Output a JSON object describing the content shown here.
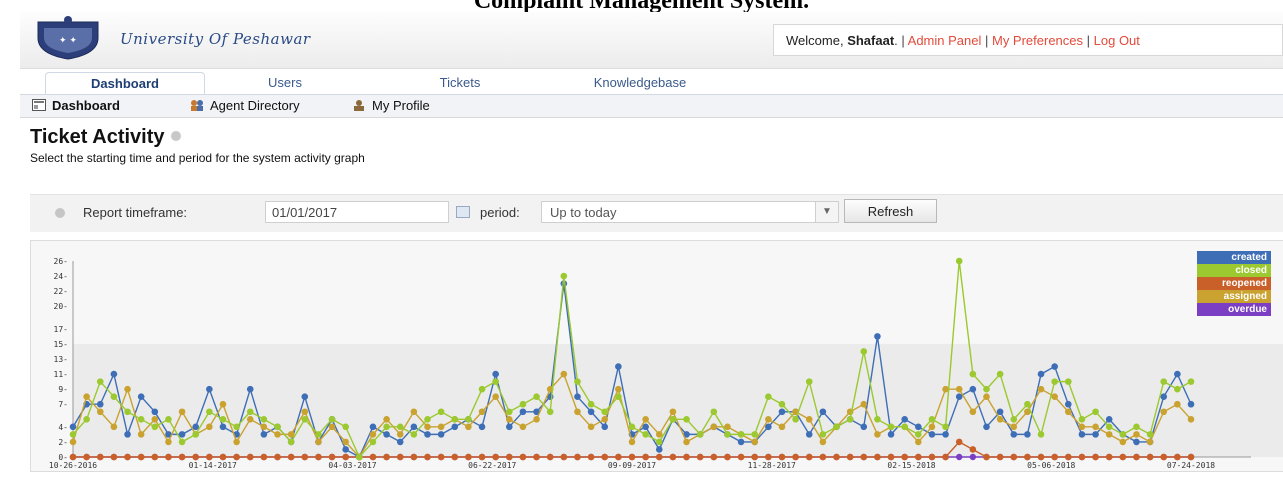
{
  "page_title": "Complaint Management System.",
  "header": {
    "logo_text": "University Of Peshawar",
    "welcome_prefix": "Welcome,",
    "user_name": "Shafaat",
    "links": [
      "Admin Panel",
      "My Preferences",
      "Log Out"
    ]
  },
  "tabs": [
    "Dashboard",
    "Users",
    "Tickets",
    "Knowledgebase"
  ],
  "subnav": [
    "Dashboard",
    "Agent Directory",
    "My Profile"
  ],
  "section": {
    "title": "Ticket Activity",
    "description": "Select the starting time and period for the system activity graph"
  },
  "filter": {
    "label": "Report timeframe:",
    "date_value": "01/01/2017",
    "period_label": "period:",
    "period_value": "Up to today",
    "refresh_label": "Refresh"
  },
  "colors": {
    "created": "#3d6eb6",
    "closed": "#9bc92f",
    "reopened": "#c9602a",
    "assigned": "#c9a22f",
    "overdue": "#7a3fc3"
  },
  "chart_data": {
    "type": "line",
    "y_ticks": [
      "0",
      "2",
      "4",
      "7",
      "9",
      "11",
      "13",
      "15",
      "17",
      "20",
      "22",
      "24",
      "26"
    ],
    "x_ticks": [
      "10-26-2016",
      "01-14-2017",
      "04-03-2017",
      "06-22-2017",
      "09-09-2017",
      "11-28-2017",
      "02-15-2018",
      "05-06-2018",
      "07-24-2018"
    ],
    "ylim": [
      0,
      26
    ],
    "legend": [
      "created",
      "closed",
      "reopened",
      "assigned",
      "overdue"
    ],
    "series": [
      {
        "name": "created",
        "values": [
          4,
          7,
          7,
          11,
          3,
          8,
          6,
          3,
          3,
          4,
          9,
          4,
          3,
          9,
          3,
          4,
          2,
          8,
          2,
          5,
          1,
          0,
          4,
          3,
          2,
          4,
          3,
          3,
          4,
          5,
          4,
          11,
          4,
          6,
          6,
          8,
          23,
          8,
          6,
          4,
          12,
          3,
          4,
          1,
          5,
          3,
          3,
          4,
          3,
          2,
          2,
          4,
          6,
          6,
          3,
          6,
          4,
          5,
          4,
          16,
          3,
          5,
          4,
          3,
          3,
          8,
          9,
          4,
          6,
          3,
          3,
          11,
          12,
          7,
          3,
          3,
          5,
          3,
          2,
          2,
          8,
          11,
          7
        ]
      },
      {
        "name": "closed",
        "values": [
          3,
          5,
          10,
          8,
          6,
          5,
          4,
          5,
          2,
          3,
          6,
          5,
          4,
          6,
          5,
          4,
          2,
          5,
          3,
          5,
          4,
          0,
          2,
          4,
          4,
          3,
          5,
          6,
          5,
          5,
          9,
          10,
          6,
          7,
          8,
          6,
          24,
          10,
          7,
          6,
          8,
          4,
          3,
          2,
          5,
          5,
          3,
          6,
          3,
          3,
          3,
          8,
          7,
          5,
          10,
          3,
          4,
          5,
          14,
          5,
          4,
          4,
          3,
          5,
          4,
          26,
          11,
          9,
          11,
          5,
          7,
          3,
          10,
          10,
          5,
          6,
          4,
          3,
          4,
          3,
          10,
          9,
          10
        ]
      },
      {
        "name": "reopened",
        "values": [
          0,
          0,
          0,
          0,
          0,
          0,
          0,
          0,
          0,
          0,
          0,
          0,
          0,
          0,
          0,
          0,
          0,
          0,
          0,
          0,
          0,
          0,
          0,
          0,
          0,
          0,
          0,
          0,
          0,
          0,
          0,
          0,
          0,
          0,
          0,
          0,
          0,
          0,
          0,
          0,
          0,
          0,
          0,
          0,
          0,
          0,
          0,
          0,
          0,
          0,
          0,
          0,
          0,
          0,
          0,
          0,
          0,
          0,
          0,
          0,
          0,
          0,
          0,
          0,
          0,
          2,
          1,
          0,
          0,
          0,
          0,
          0,
          0,
          0,
          0,
          0,
          0,
          0,
          0,
          0,
          0,
          0,
          0
        ]
      },
      {
        "name": "assigned",
        "values": [
          2,
          8,
          6,
          4,
          9,
          3,
          5,
          2,
          6,
          3,
          4,
          7,
          2,
          5,
          4,
          3,
          3,
          6,
          2,
          4,
          2,
          0,
          3,
          5,
          3,
          6,
          4,
          4,
          5,
          4,
          6,
          8,
          5,
          4,
          5,
          9,
          11,
          6,
          4,
          5,
          9,
          2,
          5,
          3,
          6,
          2,
          3,
          4,
          4,
          3,
          2,
          5,
          4,
          6,
          5,
          2,
          4,
          6,
          7,
          3,
          4,
          4,
          2,
          4,
          9,
          9,
          6,
          8,
          5,
          4,
          6,
          9,
          8,
          6,
          4,
          4,
          3,
          2,
          3,
          2,
          6,
          7,
          5
        ]
      },
      {
        "name": "overdue",
        "values": [
          0,
          0,
          0,
          0,
          0,
          0,
          0,
          0,
          0,
          0,
          0,
          0,
          0,
          0,
          0,
          0,
          0,
          0,
          0,
          0,
          0,
          0,
          0,
          0,
          0,
          0,
          0,
          0,
          0,
          0,
          0,
          0,
          0,
          0,
          0,
          0,
          0,
          0,
          0,
          0,
          0,
          0,
          0,
          0,
          0,
          0,
          0,
          0,
          0,
          0,
          0,
          0,
          0,
          0,
          0,
          0,
          0,
          0,
          0,
          0,
          0,
          0,
          0,
          0,
          0,
          0,
          0,
          0,
          0,
          0,
          0,
          0,
          0,
          0,
          0,
          0,
          0,
          0,
          0,
          0,
          0,
          0,
          0
        ]
      }
    ]
  }
}
